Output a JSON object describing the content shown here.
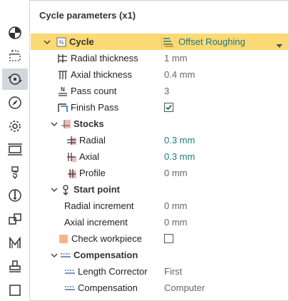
{
  "panel": {
    "title": "Cycle parameters (x1)"
  },
  "cycle": {
    "label": "Cycle",
    "value": "Offset Roughing"
  },
  "rows": {
    "radial_thickness": {
      "label": "Radial thickness",
      "value": "1 mm"
    },
    "axial_thickness": {
      "label": "Axial thickness",
      "value": "0.4 mm"
    },
    "pass_count": {
      "label": "Pass count",
      "value": "3"
    },
    "finish_pass": {
      "label": "Finish Pass",
      "checked": true
    },
    "stocks": {
      "label": "Stocks"
    },
    "stock_radial": {
      "label": "Radial",
      "value": "0.3 mm"
    },
    "stock_axial": {
      "label": "Axial",
      "value": "0.3 mm"
    },
    "stock_profile": {
      "label": "Profile",
      "value": "0 mm"
    },
    "start_point": {
      "label": "Start point"
    },
    "radial_increment": {
      "label": "Radial increment",
      "value": "0 mm"
    },
    "axial_increment": {
      "label": "Axial increment",
      "value": "0 mm"
    },
    "check_workpiece": {
      "label": "Check workpiece",
      "checked": false
    },
    "compensation_group": {
      "label": "Compensation"
    },
    "length_corrector": {
      "label": "Length Corrector",
      "value": "First"
    },
    "compensation": {
      "label": "Compensation",
      "value": "Computer"
    }
  },
  "toolbar": {
    "icons": [
      "quarter-circle-icon",
      "dashed-select-icon",
      "cycle-icon",
      "compass-icon",
      "gear-icon",
      "fixture-icon",
      "drill-icon",
      "probe-icon",
      "transform-icon",
      "macro-icon",
      "stamp-icon",
      "square-icon"
    ]
  },
  "colors": {
    "highlight": "#fbd975",
    "value_teal": "#1f7a7a",
    "active_tool": "#d3d7dc"
  }
}
